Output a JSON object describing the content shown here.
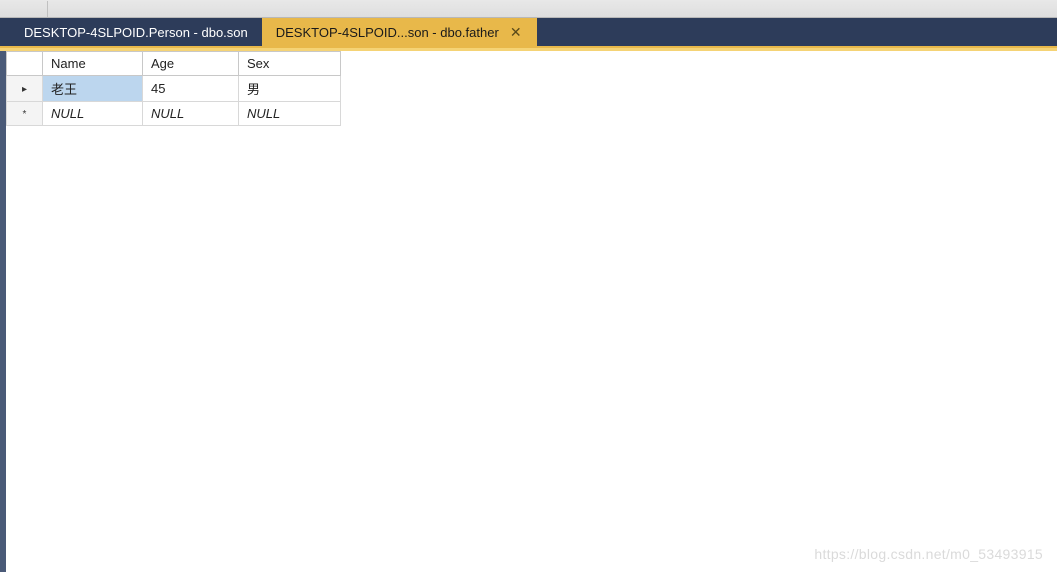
{
  "tabs": [
    {
      "label": "DESKTOP-4SLPOID.Person - dbo.son",
      "active": false,
      "closable": false
    },
    {
      "label": "DESKTOP-4SLPOID...son - dbo.father",
      "active": true,
      "closable": true
    }
  ],
  "grid": {
    "columns": [
      "Name",
      "Age",
      "Sex"
    ],
    "rows": [
      {
        "indicator": "▸",
        "cells": [
          "老王",
          "45",
          "男"
        ],
        "selectedCol": 0,
        "isNull": false
      },
      {
        "indicator": "*",
        "cells": [
          "NULL",
          "NULL",
          "NULL"
        ],
        "selectedCol": -1,
        "isNull": true
      }
    ]
  },
  "watermark": "https://blog.csdn.net/m0_53493915",
  "closeGlyph": "✕"
}
